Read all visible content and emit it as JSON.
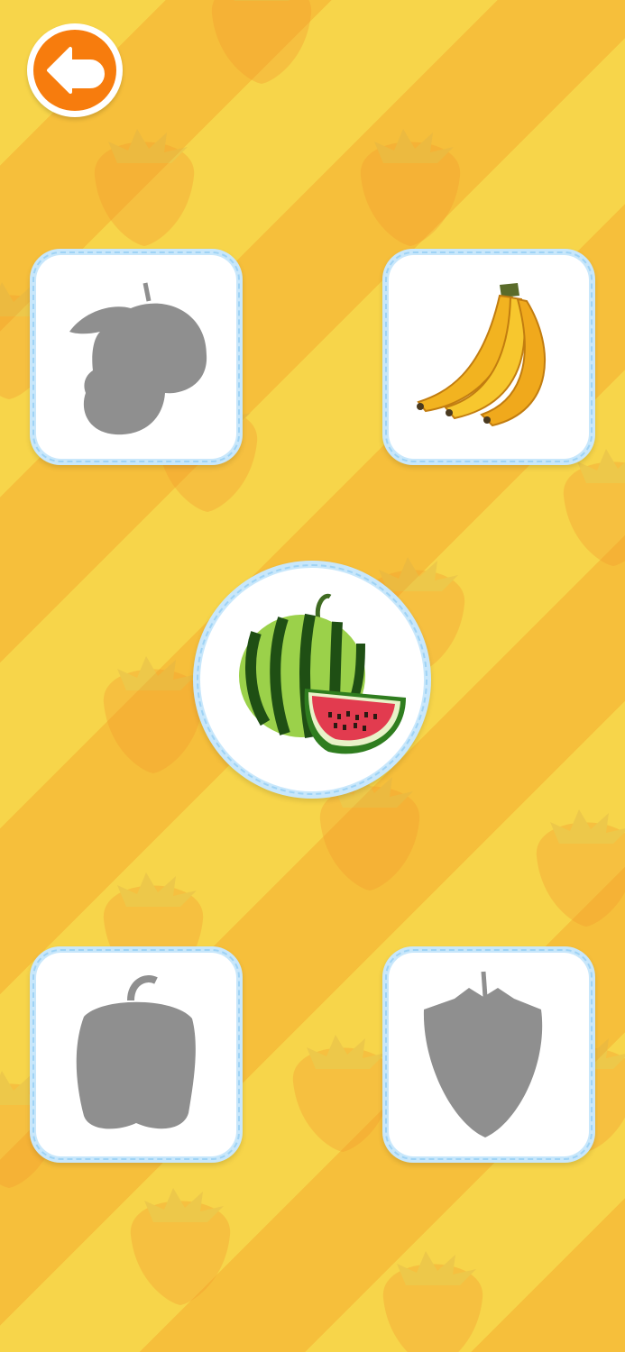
{
  "screen": {
    "background_colors": [
      "#f7d54a",
      "#f6bf3b"
    ],
    "pattern_icon": "strawberry-icon"
  },
  "back_button": {
    "icon": "back-arrow-icon",
    "color": "#f77c0d"
  },
  "cards": [
    {
      "slot": "top-left",
      "item": "apple-silhouette",
      "state": "shadow"
    },
    {
      "slot": "top-right",
      "item": "banana",
      "state": "revealed"
    },
    {
      "slot": "bottom-left",
      "item": "bell-pepper-silhouette",
      "state": "shadow"
    },
    {
      "slot": "bottom-right",
      "item": "strawberry-silhouette",
      "state": "shadow"
    }
  ],
  "target": {
    "item": "watermelon",
    "icon": "watermelon-icon"
  }
}
